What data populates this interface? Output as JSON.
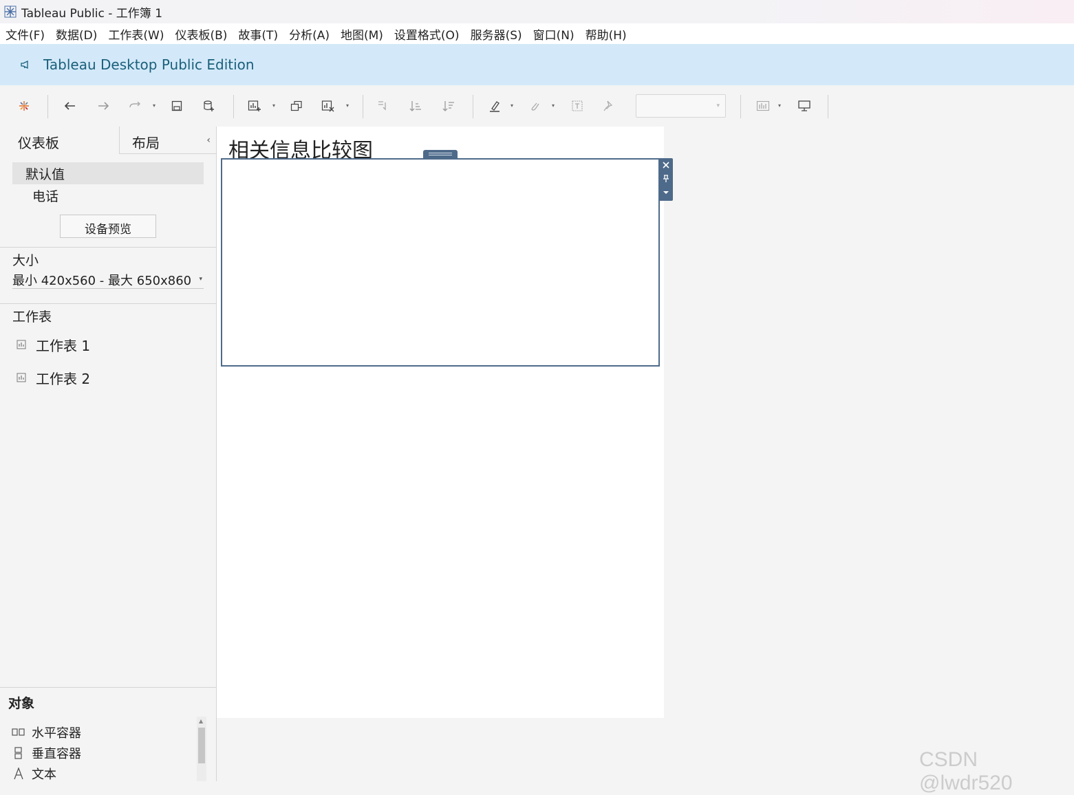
{
  "window": {
    "title": "Tableau Public - 工作簿 1"
  },
  "menu": {
    "items": [
      "文件(F)",
      "数据(D)",
      "工作表(W)",
      "仪表板(B)",
      "故事(T)",
      "分析(A)",
      "地图(M)",
      "设置格式(O)",
      "服务器(S)",
      "窗口(N)",
      "帮助(H)"
    ]
  },
  "banner": {
    "text": "Tableau Desktop Public Edition",
    "icon": "megaphone-icon"
  },
  "toolbar": {
    "icons": [
      "tableau-logo-icon",
      "undo-icon",
      "redo-icon",
      "replay-icon",
      "save-icon",
      "new-datasource-icon",
      "new-worksheet-icon",
      "duplicate-icon",
      "clear-sheet-icon",
      "swap-icon",
      "sort-ascending-icon",
      "sort-descending-icon",
      "highlight-icon",
      "group-icon",
      "show-labels-icon",
      "fix-axes-icon",
      "show-me-icon",
      "presentation-icon"
    ],
    "fit_dropdown_value": ""
  },
  "left_pane": {
    "tabs": {
      "dashboard": "仪表板",
      "layout": "布局"
    },
    "devices": {
      "default": "默认值",
      "phone": "电话"
    },
    "device_preview_button": "设备预览",
    "size": {
      "label": "大小",
      "value": "最小 420x560 - 最大 650x860"
    },
    "sheets": {
      "label": "工作表",
      "items": [
        "工作表 1",
        "工作表 2"
      ]
    },
    "objects": {
      "label": "对象",
      "items": [
        {
          "label": "水平容器",
          "icon": "horizontal-container-icon"
        },
        {
          "label": "垂直容器",
          "icon": "vertical-container-icon"
        },
        {
          "label": "文本",
          "icon": "text-icon"
        }
      ]
    }
  },
  "canvas": {
    "title": "相关信息比较图"
  },
  "watermark": "CSDN @lwdr520",
  "colors": {
    "banner_bg": "#d3e9f9",
    "banner_text": "#1a5f7a",
    "zone_border": "#4e6a8a"
  }
}
